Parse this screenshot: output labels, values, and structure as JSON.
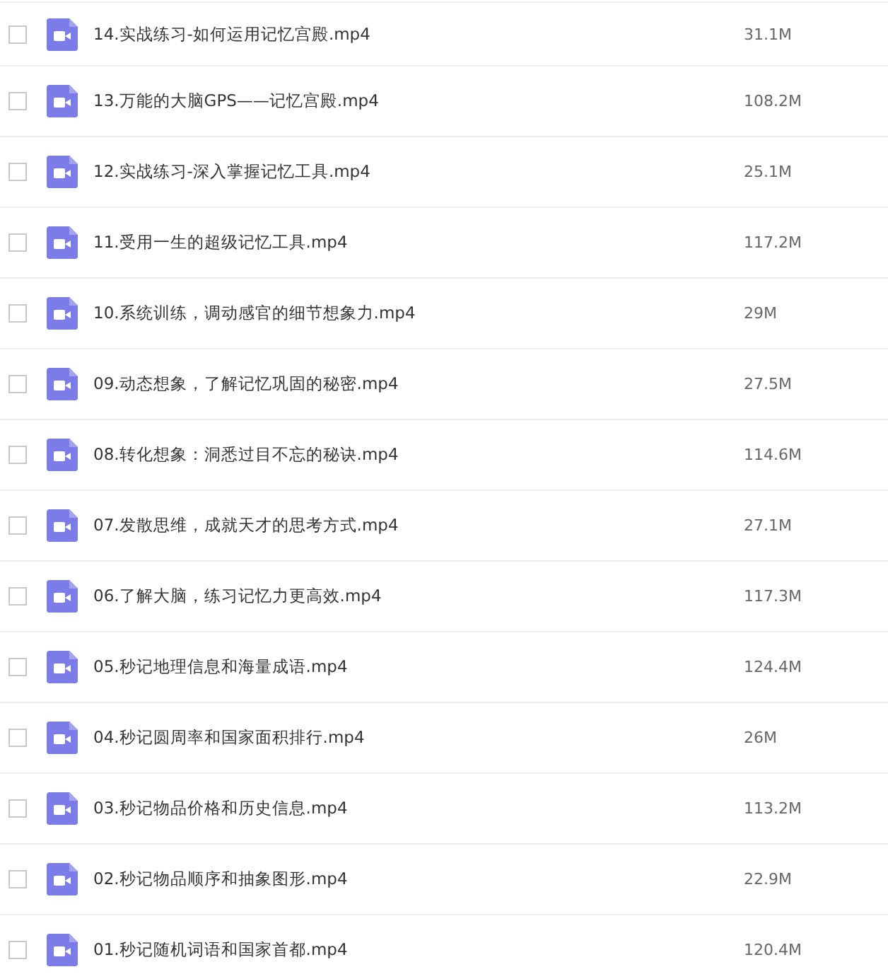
{
  "files": [
    {
      "name": "14.实战练习-如何运用记忆宫殿.mp4",
      "size": "31.1M",
      "checked": false
    },
    {
      "name": "13.万能的大脑GPS——记忆宫殿.mp4",
      "size": "108.2M",
      "checked": false
    },
    {
      "name": "12.实战练习-深入掌握记忆工具.mp4",
      "size": "25.1M",
      "checked": false
    },
    {
      "name": "11.受用一生的超级记忆工具.mp4",
      "size": "117.2M",
      "checked": false
    },
    {
      "name": "10.系统训练，调动感官的细节想象力.mp4",
      "size": "29M",
      "checked": false
    },
    {
      "name": "09.动态想象，了解记忆巩固的秘密.mp4",
      "size": "27.5M",
      "checked": false
    },
    {
      "name": "08.转化想象：洞悉过目不忘的秘诀.mp4",
      "size": "114.6M",
      "checked": false
    },
    {
      "name": "07.发散思维，成就天才的思考方式.mp4",
      "size": "27.1M",
      "checked": false
    },
    {
      "name": "06.了解大脑，练习记忆力更高效.mp4",
      "size": "117.3M",
      "checked": false
    },
    {
      "name": "05.秒记地理信息和海量成语.mp4",
      "size": "124.4M",
      "checked": false
    },
    {
      "name": "04.秒记圆周率和国家面积排行.mp4",
      "size": "26M",
      "checked": false
    },
    {
      "name": "03.秒记物品价格和历史信息.mp4",
      "size": "113.2M",
      "checked": false
    },
    {
      "name": "02.秒记物品顺序和抽象图形.mp4",
      "size": "22.9M",
      "checked": false
    },
    {
      "name": "01.秒记随机词语和国家首都.mp4",
      "size": "120.4M",
      "checked": false
    }
  ]
}
